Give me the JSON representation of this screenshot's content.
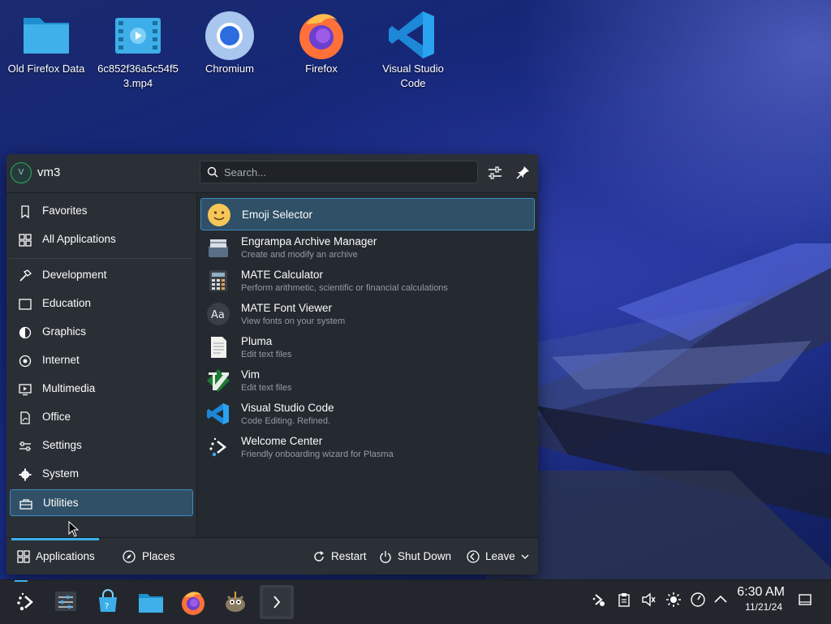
{
  "desktop": {
    "icons": [
      {
        "label": "Old Firefox Data",
        "icon": "folder-icon"
      },
      {
        "label": "6c852f36a5c54f53.mp4",
        "icon": "video-file-icon"
      },
      {
        "label": "Chromium",
        "icon": "chromium-icon"
      },
      {
        "label": "Firefox",
        "icon": "firefox-icon"
      },
      {
        "label": "Visual Studio Code",
        "icon": "vscode-icon"
      }
    ]
  },
  "launcher": {
    "user": {
      "avatar_letter": "V",
      "name": "vm3"
    },
    "search": {
      "placeholder": "Search..."
    },
    "categories": [
      {
        "label": "Favorites",
        "icon": "bookmark-icon"
      },
      {
        "label": "All Applications",
        "icon": "grid-icon"
      },
      {
        "label": "Development",
        "icon": "hammer-icon"
      },
      {
        "label": "Education",
        "icon": "education-icon"
      },
      {
        "label": "Graphics",
        "icon": "graphics-icon"
      },
      {
        "label": "Internet",
        "icon": "globe-icon"
      },
      {
        "label": "Multimedia",
        "icon": "multimedia-icon"
      },
      {
        "label": "Office",
        "icon": "office-icon"
      },
      {
        "label": "Settings",
        "icon": "sliders-icon"
      },
      {
        "label": "System",
        "icon": "gear-icon"
      },
      {
        "label": "Utilities",
        "icon": "toolbox-icon"
      }
    ],
    "selected_category": "Utilities",
    "apps": [
      {
        "name": "Emoji Selector",
        "desc": "",
        "icon": "emoji-icon"
      },
      {
        "name": "Engrampa Archive Manager",
        "desc": "Create and modify an archive",
        "icon": "archive-icon"
      },
      {
        "name": "MATE Calculator",
        "desc": "Perform arithmetic, scientific or financial calculations",
        "icon": "calculator-icon"
      },
      {
        "name": "MATE Font Viewer",
        "desc": "View fonts on your system",
        "icon": "font-viewer-icon"
      },
      {
        "name": "Pluma",
        "desc": "Edit text files",
        "icon": "text-editor-icon"
      },
      {
        "name": "Vim",
        "desc": "Edit text files",
        "icon": "vim-icon"
      },
      {
        "name": "Visual Studio Code",
        "desc": "Code Editing. Refined.",
        "icon": "vscode-icon"
      },
      {
        "name": "Welcome Center",
        "desc": "Friendly onboarding wizard for Plasma",
        "icon": "welcome-icon"
      }
    ],
    "footer": {
      "applications_label": "Applications",
      "places_label": "Places",
      "restart_label": "Restart",
      "shutdown_label": "Shut Down",
      "leave_label": "Leave"
    }
  },
  "taskbar": {
    "items": [
      {
        "icon": "app-launcher-icon"
      },
      {
        "icon": "system-settings-icon"
      },
      {
        "icon": "discover-store-icon"
      },
      {
        "icon": "file-manager-icon"
      },
      {
        "icon": "firefox-icon"
      },
      {
        "icon": "gimp-icon"
      },
      {
        "icon": "konsole-icon"
      }
    ],
    "tray": [
      "kde-connect-icon",
      "clipboard-icon",
      "volume-muted-icon",
      "brightness-icon",
      "network-icon",
      "expand-tray-icon"
    ],
    "clock": {
      "time": "6:30 AM",
      "date": "11/21/24"
    }
  },
  "colors": {
    "accent": "#3daee9",
    "panel": "#252a31",
    "selection": "#2f5067"
  }
}
